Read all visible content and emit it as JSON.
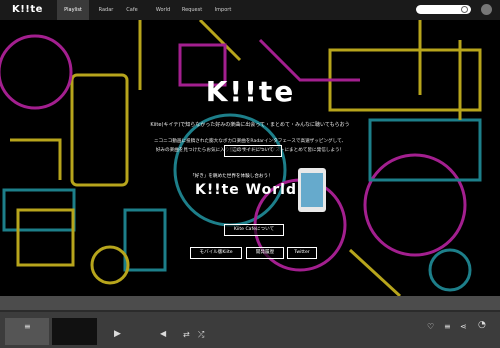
{
  "nav": {
    "logo": "K!!te",
    "items": [
      "Playlist",
      "Radar",
      "Cafe",
      "World",
      "Request",
      "Import"
    ],
    "active": "Playlist"
  },
  "auth": {
    "login": "ログイン",
    "register": "新規登録"
  },
  "hero": {
    "logo": "K!!te",
    "tagline": "Kiite(キイテ)で知らなかった好みの楽曲に出会って・まとめて・みんなに聴いてもらおう",
    "desc_line1": "ニコニコ動画に投稿された膨大なボカロ楽曲をRadarインタフェースで高速ザッピングして、",
    "desc_line2": "好みの楽曲を見つけたらお気に入り登録。それをプレイリストにまとめて皆に発信しよう！",
    "about_button": "このサイトについて",
    "world_subtitle": "「好き」を眺めた世界を体験し合おう！",
    "world_title": "K!!te World",
    "cafe_button": "Kiite Cafeについて",
    "mobile_button": "モバイル版Kiite",
    "history_button": "開発履歴",
    "twitter_button": "Twitter"
  },
  "colors": {
    "navbar": "#1a1a1a",
    "nav_active": "#3a3a3a",
    "background": "#000000",
    "player": "#3c3c3c",
    "outline_yellow": "#b7a51c",
    "outline_magenta": "#a31f8f",
    "outline_cyan": "#1d7f8a"
  },
  "player": {
    "icons": [
      "queue-icon",
      "play-icon",
      "volume-icon",
      "repeat-icon",
      "shuffle-icon",
      "heart-icon",
      "playlist-add-icon",
      "share-icon",
      "open-icon"
    ]
  }
}
